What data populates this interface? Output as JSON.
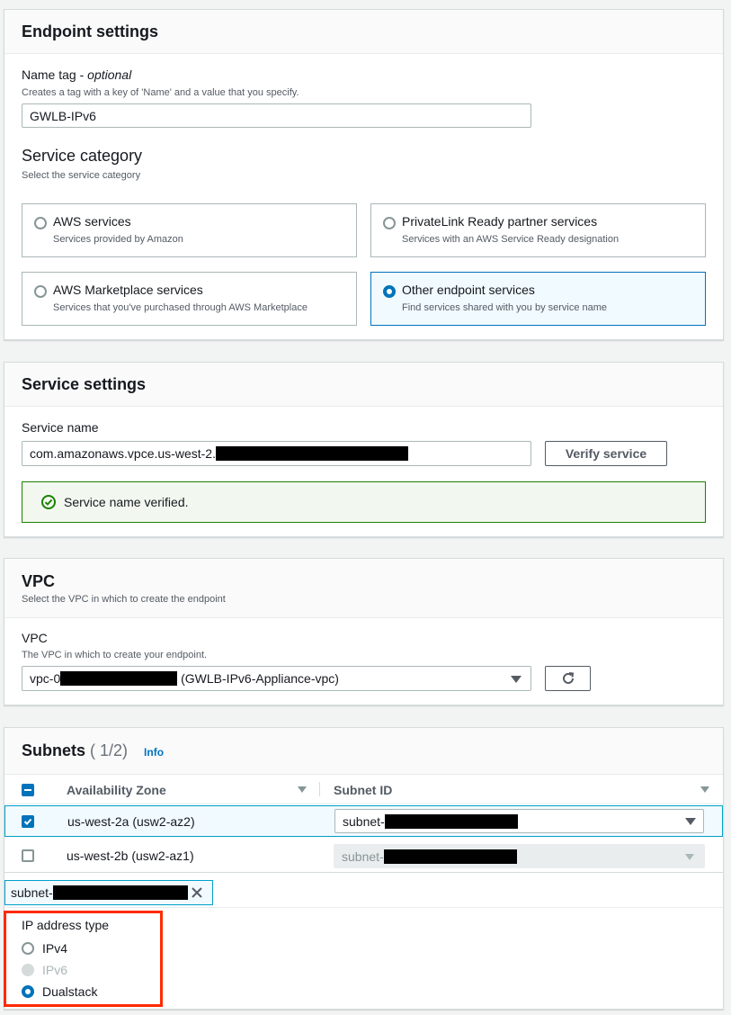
{
  "endpoint_settings": {
    "title": "Endpoint settings",
    "name_tag_label": "Name tag",
    "name_tag_optional": "optional",
    "name_tag_desc": "Creates a tag with a key of 'Name' and a value that you specify.",
    "name_tag_value": "GWLB-IPv6",
    "service_category_title": "Service category",
    "service_category_desc": "Select the service category",
    "options": [
      {
        "title": "AWS services",
        "sub": "Services provided by Amazon",
        "selected": false
      },
      {
        "title": "PrivateLink Ready partner services",
        "sub": "Services with an AWS Service Ready designation",
        "selected": false
      },
      {
        "title": "AWS Marketplace services",
        "sub": "Services that you've purchased through AWS Marketplace",
        "selected": false
      },
      {
        "title": "Other endpoint services",
        "sub": "Find services shared with you by service name",
        "selected": true
      }
    ]
  },
  "service_settings": {
    "title": "Service settings",
    "service_name_label": "Service name",
    "service_name_value": "com.amazonaws.vpce.us-west-2.",
    "verify_button": "Verify service",
    "verified_message": "Service name verified."
  },
  "vpc": {
    "title": "VPC",
    "desc": "Select the VPC in which to create the endpoint",
    "field_label": "VPC",
    "field_desc": "The VPC in which to create your endpoint.",
    "value_prefix": "vpc-0",
    "value_suffix": "(GWLB-IPv6-Appliance-vpc)"
  },
  "subnets": {
    "title": "Subnets",
    "count": "( 1/2)",
    "info": "Info",
    "col_az": "Availability Zone",
    "col_subnet": "Subnet ID",
    "rows": [
      {
        "az": "us-west-2a (usw2-az2)",
        "subnet": "subnet-",
        "checked": true
      },
      {
        "az": "us-west-2b (usw2-az1)",
        "subnet": "subnet-",
        "checked": false
      }
    ],
    "token_value": "subnet-"
  },
  "ip_address_type": {
    "label": "IP address type",
    "options": [
      {
        "label": "IPv4",
        "state": "unchecked"
      },
      {
        "label": "IPv6",
        "state": "disabled"
      },
      {
        "label": "Dualstack",
        "state": "checked"
      }
    ]
  },
  "colors": {
    "accent": "#0073bb",
    "success": "#1d8102",
    "highlight": "#ff2a00"
  }
}
